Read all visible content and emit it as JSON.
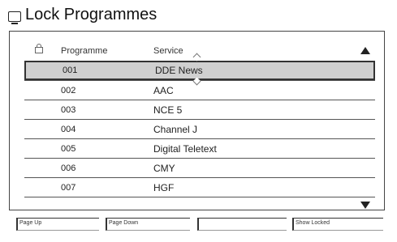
{
  "header": {
    "title": "Lock Programmes"
  },
  "columns": {
    "programme": "Programme",
    "service": "Service"
  },
  "rows": [
    {
      "programme": "001",
      "service": "DDE News",
      "selected": true
    },
    {
      "programme": "002",
      "service": "AAC",
      "selected": false
    },
    {
      "programme": "003",
      "service": "NCE 5",
      "selected": false
    },
    {
      "programme": "004",
      "service": "Channel J",
      "selected": false
    },
    {
      "programme": "005",
      "service": "Digital Teletext",
      "selected": false
    },
    {
      "programme": "006",
      "service": "CMY",
      "selected": false
    },
    {
      "programme": "007",
      "service": "HGF",
      "selected": false
    }
  ],
  "function_bar": {
    "page_up": "Page Up",
    "page_down": "Page Down",
    "blank": "",
    "show_locked": "Show Locked"
  },
  "icons": {
    "title": "tv-screen-icon",
    "lock_column": "padlock-icon",
    "scroll_up": "triangle-up-icon",
    "scroll_down": "triangle-down-icon"
  }
}
